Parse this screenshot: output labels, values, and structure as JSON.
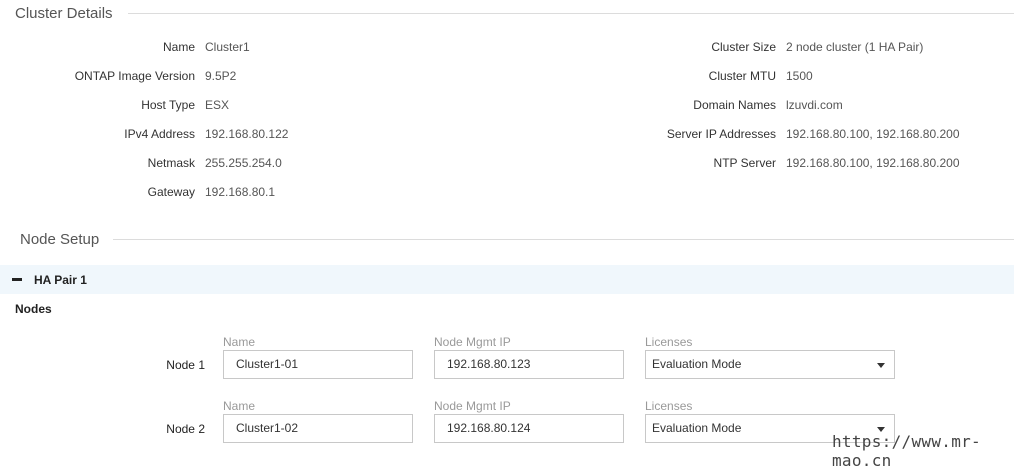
{
  "cluster_details": {
    "title": "Cluster Details",
    "left": [
      {
        "label": "Name",
        "value": "Cluster1"
      },
      {
        "label": "ONTAP Image Version",
        "value": "9.5P2"
      },
      {
        "label": "Host Type",
        "value": "ESX"
      },
      {
        "label": "IPv4 Address",
        "value": "192.168.80.122"
      },
      {
        "label": "Netmask",
        "value": "255.255.254.0"
      },
      {
        "label": "Gateway",
        "value": "192.168.80.1"
      }
    ],
    "right": [
      {
        "label": "Cluster Size",
        "value": "2 node cluster (1 HA Pair)"
      },
      {
        "label": "Cluster MTU",
        "value": "1500"
      },
      {
        "label": "Domain Names",
        "value": "lzuvdi.com"
      },
      {
        "label": "Server IP Addresses",
        "value": "192.168.80.100, 192.168.80.200"
      },
      {
        "label": "NTP Server",
        "value": "192.168.80.100, 192.168.80.200"
      }
    ]
  },
  "node_setup": {
    "title": "Node Setup",
    "ha_pair": {
      "title": "HA Pair 1",
      "toggle_icon": "minus-icon"
    },
    "nodes_heading": "Nodes",
    "columns": {
      "name": "Name",
      "mgmt_ip": "Node Mgmt IP",
      "licenses": "Licenses"
    },
    "nodes": [
      {
        "label": "Node 1",
        "name": "Cluster1-01",
        "mgmt_ip": "192.168.80.123",
        "license": "Evaluation Mode"
      },
      {
        "label": "Node 2",
        "name": "Cluster1-02",
        "mgmt_ip": "192.168.80.124",
        "license": "Evaluation Mode"
      }
    ]
  },
  "watermark": "https://www.mr-mao.cn"
}
